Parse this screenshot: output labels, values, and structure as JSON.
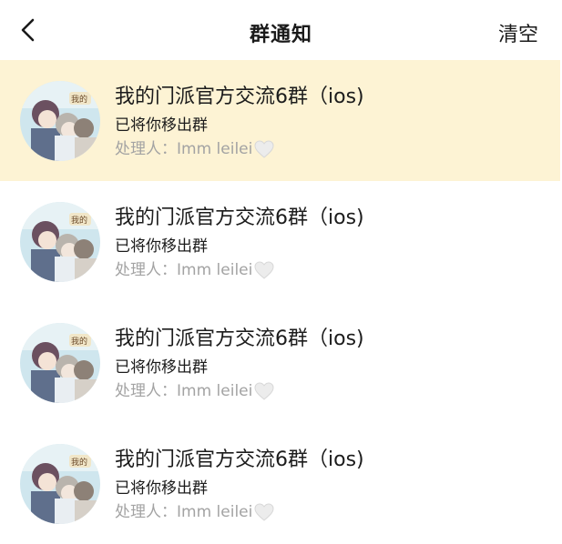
{
  "header": {
    "title": "群通知",
    "clear_label": "清空",
    "back_icon": "chevron-left-icon"
  },
  "notifications": [
    {
      "group_name": "我的门派官方交流6群（ios)",
      "action": "已将你移出群",
      "handler_label": "处理人：",
      "handler_name": "Imm leilei",
      "handler_icon": "white-heart-icon",
      "highlighted": true
    },
    {
      "group_name": "我的门派官方交流6群（ios)",
      "action": "已将你移出群",
      "handler_label": "处理人：",
      "handler_name": "Imm leilei",
      "handler_icon": "white-heart-icon",
      "highlighted": false
    },
    {
      "group_name": "我的门派官方交流6群（ios)",
      "action": "已将你移出群",
      "handler_label": "处理人：",
      "handler_name": "Imm leilei",
      "handler_icon": "white-heart-icon",
      "highlighted": false
    },
    {
      "group_name": "我的门派官方交流6群（ios)",
      "action": "已将你移出群",
      "handler_label": "处理人：",
      "handler_name": "Imm leilei",
      "handler_icon": "white-heart-icon",
      "highlighted": false
    }
  ],
  "colors": {
    "highlight_bg": "#fdf3d4",
    "secondary_text": "#a3a3a3",
    "primary_text": "#1c1c1c"
  }
}
